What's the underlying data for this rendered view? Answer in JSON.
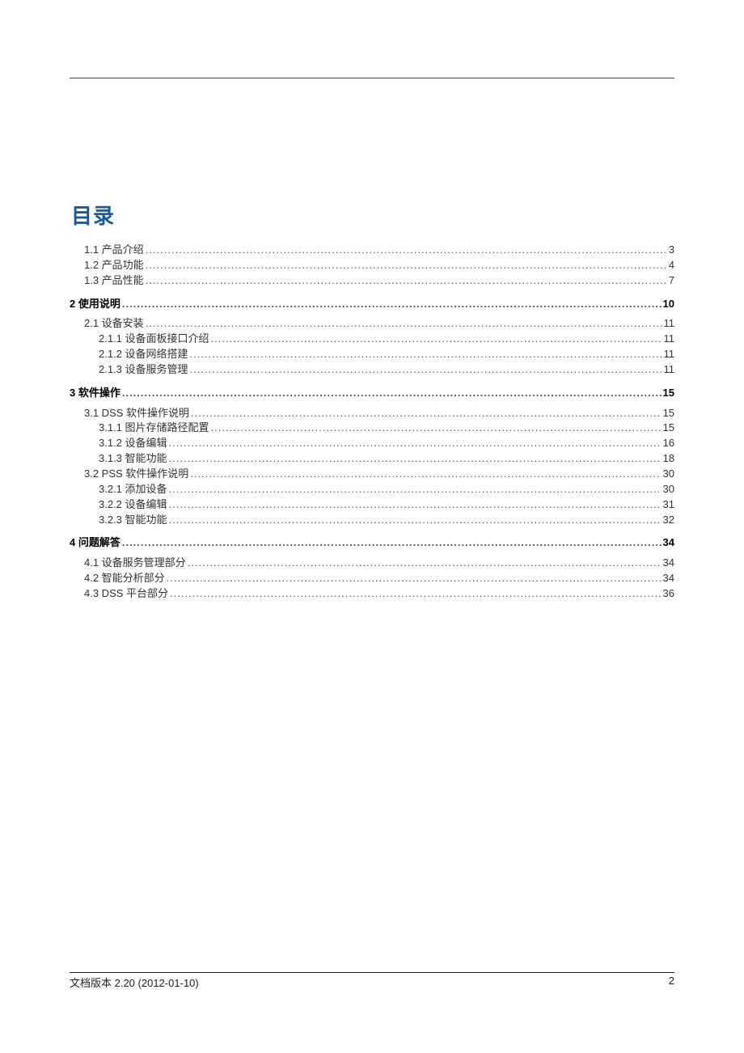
{
  "title": "目录",
  "footer": {
    "left": "文档版本  2.20 (2012-01-10)",
    "right": "2"
  },
  "toc": [
    {
      "level": 1,
      "label": "1.1",
      "text": "产品介绍",
      "page": "3"
    },
    {
      "level": 1,
      "label": "1.2",
      "text": "产品功能",
      "page": "4"
    },
    {
      "level": 1,
      "label": "1.3",
      "text": "产品性能",
      "page": "7"
    },
    {
      "level": 0,
      "label": "2",
      "text": "使用说明",
      "page": "10",
      "bold": true,
      "section": true
    },
    {
      "level": 1,
      "label": "2.1",
      "text": "设备安装",
      "page": "11"
    },
    {
      "level": 2,
      "label": "2.1.1",
      "text": "设备面板接口介绍",
      "page": "11"
    },
    {
      "level": 2,
      "label": "2.1.2",
      "text": "设备网络搭建",
      "page": "11"
    },
    {
      "level": 2,
      "label": "2.1.3",
      "text": "设备服务管理",
      "page": "11"
    },
    {
      "level": 0,
      "label": "3",
      "text": "软件操作",
      "page": "15",
      "bold": true,
      "section": true
    },
    {
      "level": 1,
      "label": "3.1 DSS",
      "text": "软件操作说明",
      "page": "15"
    },
    {
      "level": 2,
      "label": "3.1.1",
      "text": "图片存储路径配置",
      "page": "15"
    },
    {
      "level": 2,
      "label": "3.1.2",
      "text": "设备编辑",
      "page": "16"
    },
    {
      "level": 2,
      "label": "3.1.3",
      "text": "智能功能",
      "page": "18"
    },
    {
      "level": 1,
      "label": "3.2 PSS",
      "text": "软件操作说明",
      "page": "30"
    },
    {
      "level": 2,
      "label": "3.2.1",
      "text": "添加设备",
      "page": "30"
    },
    {
      "level": 2,
      "label": "3.2.2",
      "text": "设备编辑",
      "page": "31"
    },
    {
      "level": 2,
      "label": "3.2.3",
      "text": "智能功能",
      "page": "32"
    },
    {
      "level": 0,
      "label": "4",
      "text": "问题解答",
      "page": "34",
      "bold": true,
      "section": true
    },
    {
      "level": 1,
      "label": "4.1",
      "text": "设备服务管理部分",
      "page": "34"
    },
    {
      "level": 1,
      "label": "4.2",
      "text": "智能分析部分",
      "page": "34"
    },
    {
      "level": 1,
      "label": "4.3 DSS",
      "text": "平台部分",
      "page": "36"
    }
  ]
}
